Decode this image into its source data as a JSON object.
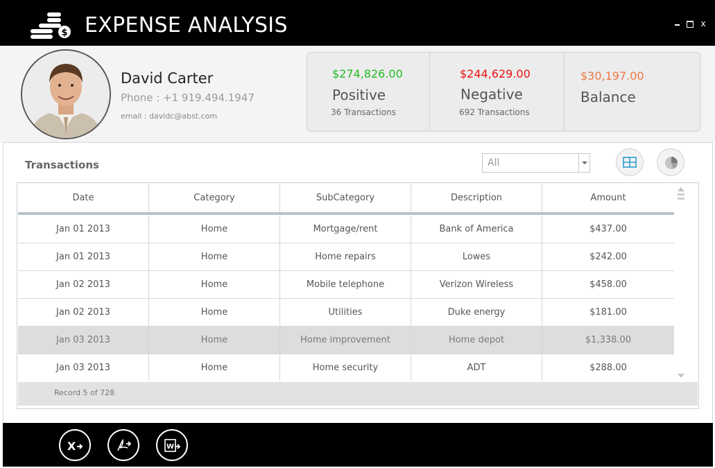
{
  "app": {
    "title": "EXPENSE ANALYSIS",
    "logo_icon": "coins-dollar-icon",
    "window_controls": {
      "close_label": "x"
    }
  },
  "user": {
    "name": "David Carter",
    "phone": "Phone : +1 919.494.1947",
    "email": "email : davidc@abst.com"
  },
  "summary": {
    "positive": {
      "amount": "$274,826.00",
      "label": "Positive",
      "count": "36 Transactions",
      "color": "#22bb22"
    },
    "negative": {
      "amount": "$244,629.00",
      "label": "Negative",
      "count": "692 Transactions",
      "color": "#ee1111"
    },
    "balance": {
      "amount": "$30,197.00",
      "label": "Balance",
      "color": "#ee7744"
    }
  },
  "transactions": {
    "title": "Transactions",
    "filter": {
      "selected": "All"
    },
    "view_buttons": [
      "grid-view-icon",
      "pie-chart-icon"
    ],
    "columns": [
      "Date",
      "Category",
      "SubCategory",
      "Description",
      "Amount"
    ],
    "rows": [
      [
        "Jan 01 2013",
        "Home",
        "Mortgage/rent",
        "Bank of America",
        "$437.00"
      ],
      [
        "Jan 01 2013",
        "Home",
        "Home repairs",
        "Lowes",
        "$242.00"
      ],
      [
        "Jan 02 2013",
        "Home",
        "Mobile telephone",
        "Verizon Wireless",
        "$458.00"
      ],
      [
        "Jan 02 2013",
        "Home",
        "Utilities",
        "Duke energy",
        "$181.00"
      ],
      [
        "Jan 03 2013",
        "Home",
        "Home improvement",
        "Home depot",
        "$1,338.00"
      ],
      [
        "Jan 03 2013",
        "Home",
        "Home security",
        "ADT",
        "$288.00"
      ]
    ],
    "selected_row_index": 4,
    "record_status": "Record 5 of 728"
  },
  "export_buttons": [
    "export-excel-icon",
    "export-pdf-icon",
    "export-word-icon"
  ]
}
